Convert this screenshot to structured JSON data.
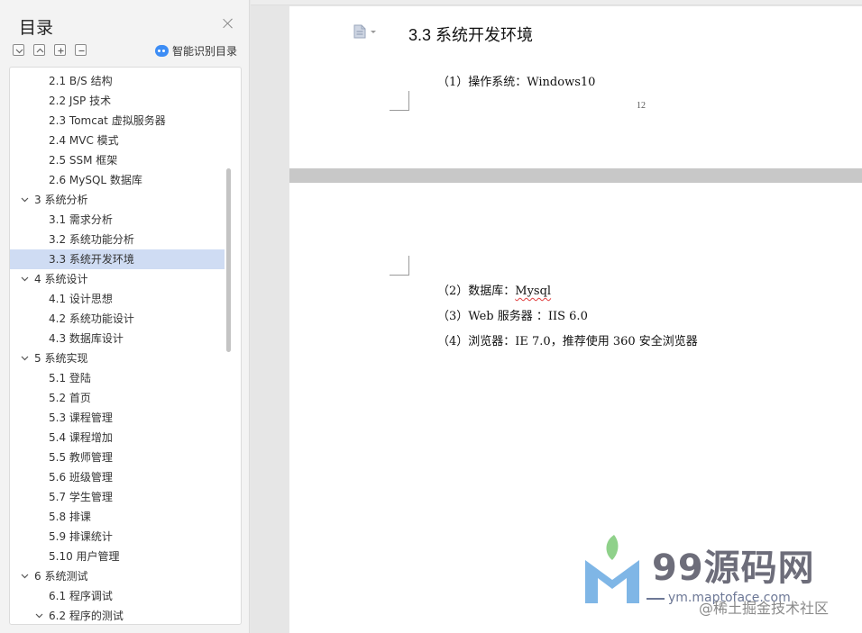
{
  "sidebar": {
    "title": "目录",
    "smart_label": "智能识别目录",
    "items": [
      {
        "label": "2.1 B/S 结构",
        "level": 2
      },
      {
        "label": "2.2 JSP 技术",
        "level": 2
      },
      {
        "label": "2.3 Tomcat 虚拟服务器",
        "level": 2
      },
      {
        "label": "2.4 MVC 模式",
        "level": 2
      },
      {
        "label": "2.5 SSM 框架",
        "level": 2
      },
      {
        "label": "2.6 MySQL 数据库",
        "level": 2
      },
      {
        "label": "3 系统分析",
        "level": 1,
        "expanded": true
      },
      {
        "label": "3.1 需求分析",
        "level": 2
      },
      {
        "label": "3.2 系统功能分析",
        "level": 2
      },
      {
        "label": "3.3 系统开发环境",
        "level": 2,
        "active": true
      },
      {
        "label": "4 系统设计",
        "level": 1,
        "expanded": true
      },
      {
        "label": "4.1 设计思想",
        "level": 2
      },
      {
        "label": "4.2 系统功能设计",
        "level": 2
      },
      {
        "label": "4.3 数据库设计",
        "level": 2
      },
      {
        "label": "5 系统实现",
        "level": 1,
        "expanded": true
      },
      {
        "label": "5.1 登陆",
        "level": 2
      },
      {
        "label": "5.2 首页",
        "level": 2
      },
      {
        "label": "5.3 课程管理",
        "level": 2
      },
      {
        "label": "5.4 课程增加",
        "level": 2
      },
      {
        "label": "5.5 教师管理",
        "level": 2
      },
      {
        "label": "5.6 班级管理",
        "level": 2
      },
      {
        "label": "5.7 学生管理",
        "level": 2
      },
      {
        "label": "5.8 排课",
        "level": 2
      },
      {
        "label": "5.9 排课统计",
        "level": 2
      },
      {
        "label": "5.10 用户管理",
        "level": 2
      },
      {
        "label": "6 系统测试",
        "level": 1,
        "expanded": true
      },
      {
        "label": "6.1  程序调试",
        "level": 2
      },
      {
        "label": "6.2  程序的测试",
        "level": 2,
        "expanded": true
      }
    ]
  },
  "document": {
    "heading": "3.3 系统开发环境",
    "page1_line": "（1）操作系统：Windows10",
    "page_number": "12",
    "line2_prefix": "（2）数据库：",
    "line2_value": "Mysql",
    "line3": "（3）Web  服务器  ：IIS 6.0",
    "line4": "（4）浏览器：IE 7.0，推荐使用 360 安全浏览器"
  },
  "watermark": {
    "text": "99源码网",
    "url": "ym.maptoface.com",
    "brand": "@稀土掘金技术社区"
  },
  "colors": {
    "active_item": "#cfdcf3",
    "smart_icon": "#3d8df5",
    "watermark_text": "#6d6d7a"
  }
}
